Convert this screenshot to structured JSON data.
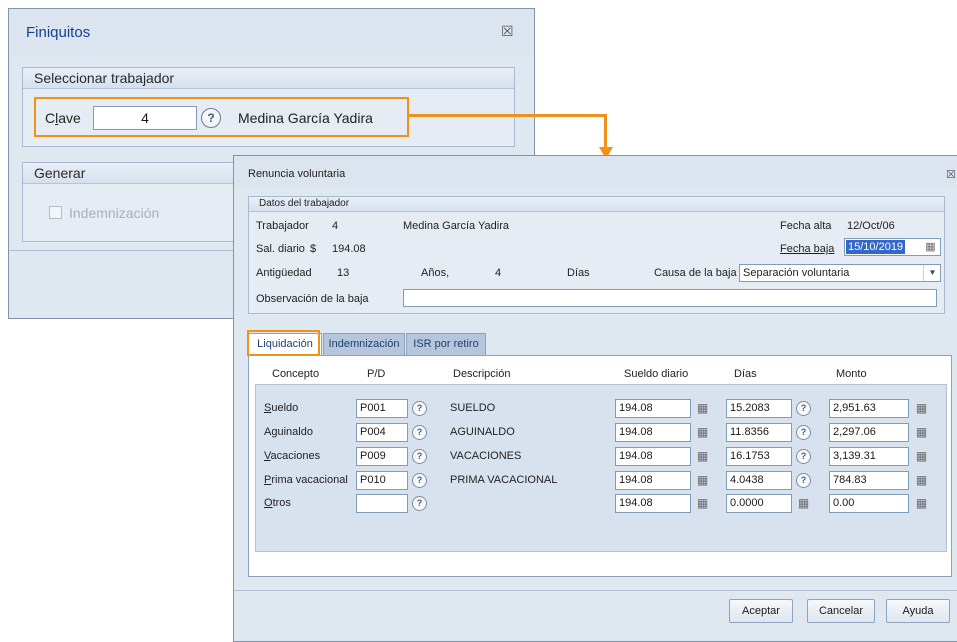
{
  "finiquitos": {
    "title": "Finiquitos",
    "select_group_title": "Seleccionar trabajador",
    "clave_label_pre": "C",
    "clave_label_post": "ave",
    "clave_label_ul": "l",
    "clave_value": "4",
    "worker_name": "Medina García Yadira",
    "generar_group_title": "Generar",
    "indemnizacion_label": "Indemnización"
  },
  "renuncia": {
    "title": "Renuncia voluntaria",
    "datos_group_title": "Datos del trabajador",
    "trabajador_label": "Trabajador",
    "trabajador_id": "4",
    "trabajador_name": "Medina García Yadira",
    "fecha_alta_label": "Fecha alta",
    "fecha_alta_value": "12/Oct/06",
    "sal_diario_label": "Sal. diario",
    "currency_symbol": "$",
    "sal_diario_value": "194.08",
    "fecha_baja_label": "Fecha baja",
    "fecha_baja_value": "15/10/2019",
    "antiguedad_label": "Antigüedad",
    "antiguedad_years_value": "13",
    "anos_label": "Años,",
    "dias_value": "4",
    "dias_label": "Días",
    "causa_label": "Causa de la baja",
    "causa_value": "Separación voluntaria",
    "observacion_label": "Observación de la baja",
    "observacion_value": ""
  },
  "tabs": [
    {
      "label": "Liquidación"
    },
    {
      "label": "Indemnización"
    },
    {
      "label": "ISR por retiro"
    }
  ],
  "table": {
    "headers": {
      "concepto": "Concepto",
      "pd": "P/D",
      "descripcion": "Descripción",
      "sueldo_diario": "Sueldo diario",
      "dias": "Días",
      "monto": "Monto"
    },
    "rows": [
      {
        "concepto": "Sueldo",
        "pd": "P001",
        "descripcion": "SUELDO",
        "sueldo": "194.08",
        "dias": "15.2083",
        "monto": "2,951.63"
      },
      {
        "concepto": "Aguinaldo",
        "pd": "P004",
        "descripcion": "AGUINALDO",
        "sueldo": "194.08",
        "dias": "11.8356",
        "monto": "2,297.06"
      },
      {
        "concepto": "Vacaciones",
        "pd": "P009",
        "descripcion": "VACACIONES",
        "sueldo": "194.08",
        "dias": "16.1753",
        "monto": "3,139.31"
      },
      {
        "concepto": "Prima vacacional",
        "pd": "P010",
        "descripcion": "PRIMA VACACIONAL",
        "sueldo": "194.08",
        "dias": "4.0438",
        "monto": "784.83"
      },
      {
        "concepto": "Otros",
        "pd": "",
        "descripcion": "",
        "sueldo": "194.08",
        "dias": "0.0000",
        "monto": "0.00"
      }
    ]
  },
  "buttons": {
    "aceptar": "Aceptar",
    "cancelar": "Cancelar",
    "ayuda": "Ayuda"
  },
  "icons": {
    "help": "?",
    "close": "☒"
  },
  "colors": {
    "highlight": "#f0911b",
    "window_bg": "#dfe7f1",
    "title_text": "#15428b",
    "selected_text_bg": "#3367c9"
  }
}
